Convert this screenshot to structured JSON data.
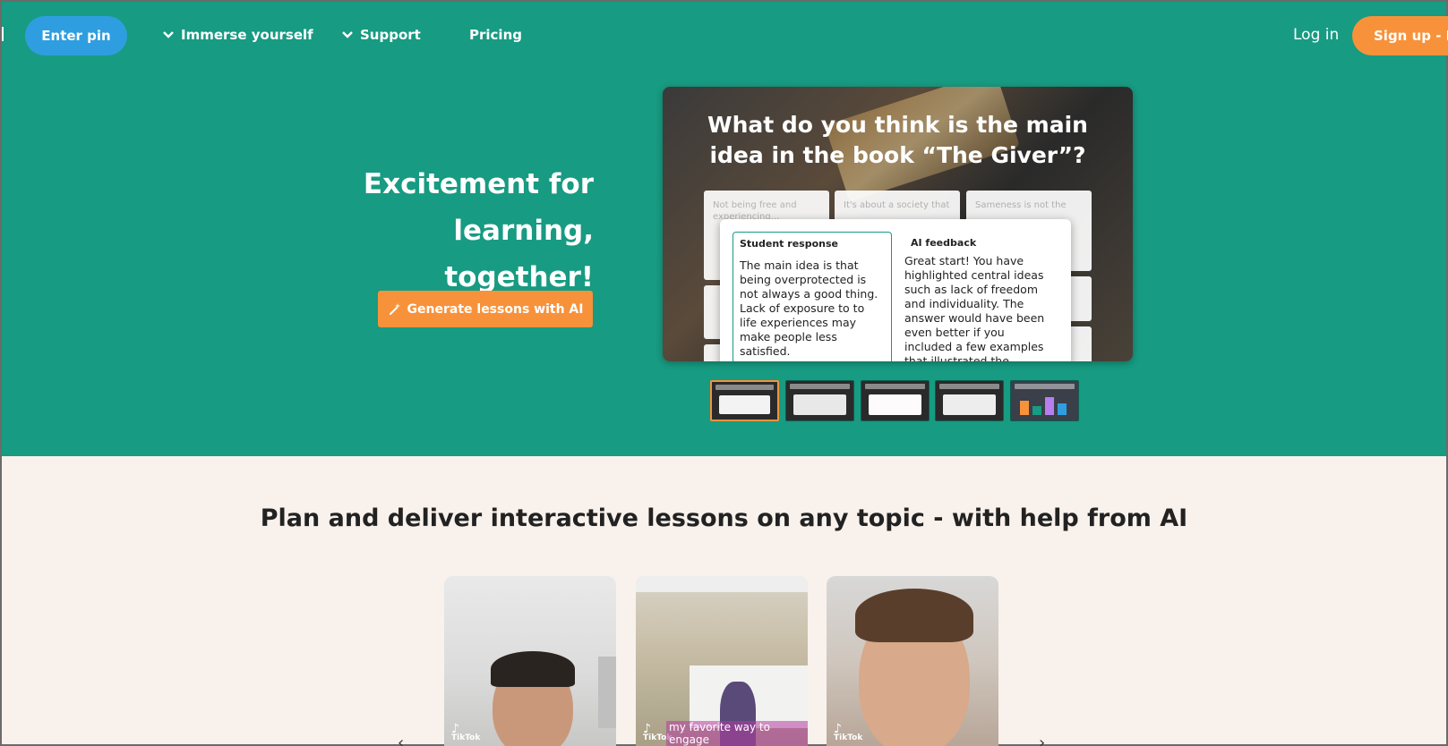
{
  "nav": {
    "enter_pin": "Enter pin",
    "immerse": "Immerse yourself",
    "support": "Support",
    "pricing": "Pricing",
    "login": "Log in",
    "signup": "Sign up - It"
  },
  "hero": {
    "title_line1": "Excitement for",
    "title_line2": "learning, together!",
    "generate_button": "Generate lessons with AI"
  },
  "slide": {
    "question": "What do you think is the main idea in the book “The Giver”?",
    "ghost_cards": [
      "Not being free and experiencing...",
      "It's about a society that",
      "Sameness is not the"
    ],
    "response_header": "Student response",
    "response_text": "The main idea is that being overprotected is not always a good thing. Lack of exposure to to life experiences may make people less satisfied.",
    "feedback_header": "AI feedback",
    "feedback_text": "Great start! You have highlighted central ideas such as lack of freedom and individuality. The answer would have been even better if you included a few examples that illustrated the..."
  },
  "thumbnails": [
    {
      "label": "slide-thumb-1",
      "active": true
    },
    {
      "label": "slide-thumb-2",
      "active": false
    },
    {
      "label": "slide-thumb-3",
      "active": false
    },
    {
      "label": "slide-thumb-4",
      "active": false
    },
    {
      "label": "slide-thumb-5",
      "active": false
    }
  ],
  "section": {
    "title": "Plan and deliver interactive lessons on any topic - with help from AI"
  },
  "videos": [
    {
      "brand": "TikTok",
      "caption": ""
    },
    {
      "brand": "TikTok",
      "caption": "my favorite way to engage"
    },
    {
      "brand": "TikTok",
      "caption": ""
    }
  ],
  "carousel": {
    "prev": "‹",
    "next": "›"
  },
  "colors": {
    "hero_bg": "#179b82",
    "accent_orange": "#f7923b",
    "pin_blue": "#2f9ee0",
    "page_bg": "#f9f1ec"
  }
}
